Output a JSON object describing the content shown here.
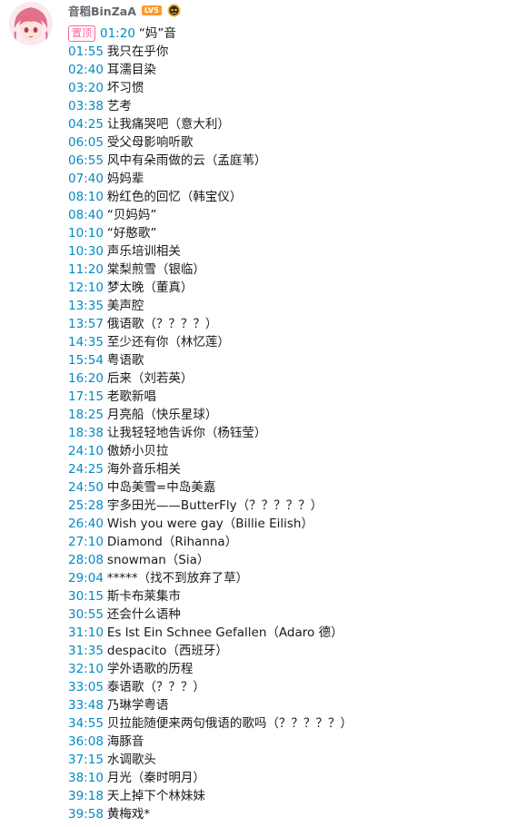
{
  "user": {
    "name": "音稻BinZaA",
    "level": "LV5"
  },
  "pin_label": "置顶",
  "entries": [
    {
      "time": "01:20",
      "label": "“妈”音"
    },
    {
      "time": "01:55",
      "label": "我只在乎你"
    },
    {
      "time": "02:40",
      "label": "耳濡目染"
    },
    {
      "time": "03:20",
      "label": "坏习惯"
    },
    {
      "time": "03:38",
      "label": "艺考"
    },
    {
      "time": "04:25",
      "label": "让我痛哭吧（意大利）"
    },
    {
      "time": "06:05",
      "label": "受父母影响听歌"
    },
    {
      "time": "06:55",
      "label": "风中有朵雨做的云（孟庭苇）"
    },
    {
      "time": "07:40",
      "label": "妈妈辈"
    },
    {
      "time": "08:10",
      "label": "粉红色的回忆（韩宝仪）"
    },
    {
      "time": "08:40",
      "label": "“贝妈妈”"
    },
    {
      "time": "10:10",
      "label": "“好憨歌”"
    },
    {
      "time": "10:30",
      "label": "声乐培训相关"
    },
    {
      "time": "11:20",
      "label": "棠梨煎雪（银临）"
    },
    {
      "time": "12:10",
      "label": "梦太晚（董真）"
    },
    {
      "time": "13:35",
      "label": "美声腔"
    },
    {
      "time": "13:57",
      "label": "俄语歌（？？？？）"
    },
    {
      "time": "14:35",
      "label": "至少还有你（林忆莲）"
    },
    {
      "time": "15:54",
      "label": "粤语歌"
    },
    {
      "time": "16:20",
      "label": "后来（刘若英）"
    },
    {
      "time": "17:15",
      "label": "老歌新唱"
    },
    {
      "time": "18:25",
      "label": "月亮船（快乐星球）"
    },
    {
      "time": "18:38",
      "label": "让我轻轻地告诉你（杨钰莹）"
    },
    {
      "time": "24:10",
      "label": "傲娇小贝拉"
    },
    {
      "time": "24:25",
      "label": "海外音乐相关"
    },
    {
      "time": "24:50",
      "label": "中岛美雪=中岛美嘉"
    },
    {
      "time": "25:28",
      "label": "宇多田光——ButterFly（？？？？？）"
    },
    {
      "time": "26:40",
      "label": "Wish you were gay（Billie Eilish）"
    },
    {
      "time": "27:10",
      "label": "Diamond（Rihanna）"
    },
    {
      "time": "28:08",
      "label": "snowman（Sia）"
    },
    {
      "time": "29:04",
      "label": "*****（找不到放弃了草）"
    },
    {
      "time": "30:15",
      "label": "斯卡布莱集市"
    },
    {
      "time": "30:55",
      "label": "还会什么语种"
    },
    {
      "time": "31:10",
      "label": "Es lst Ein Schnee Gefallen（Adaro 德）"
    },
    {
      "time": "31:35",
      "label": "despacito（西班牙）"
    },
    {
      "time": "32:10",
      "label": "学外语歌的历程"
    },
    {
      "time": "33:05",
      "label": "泰语歌（？？？）"
    },
    {
      "time": "33:48",
      "label": "乃琳学粤语"
    },
    {
      "time": "34:55",
      "label": "贝拉能随便来两句俄语的歌吗（？？？？？）"
    },
    {
      "time": "36:08",
      "label": "海豚音"
    },
    {
      "time": "37:15",
      "label": "水调歌头"
    },
    {
      "time": "38:10",
      "label": "月光（秦时明月）"
    },
    {
      "time": "39:18",
      "label": "天上掉下个林妹妹"
    },
    {
      "time": "39:58",
      "label": "黄梅戏*"
    }
  ]
}
